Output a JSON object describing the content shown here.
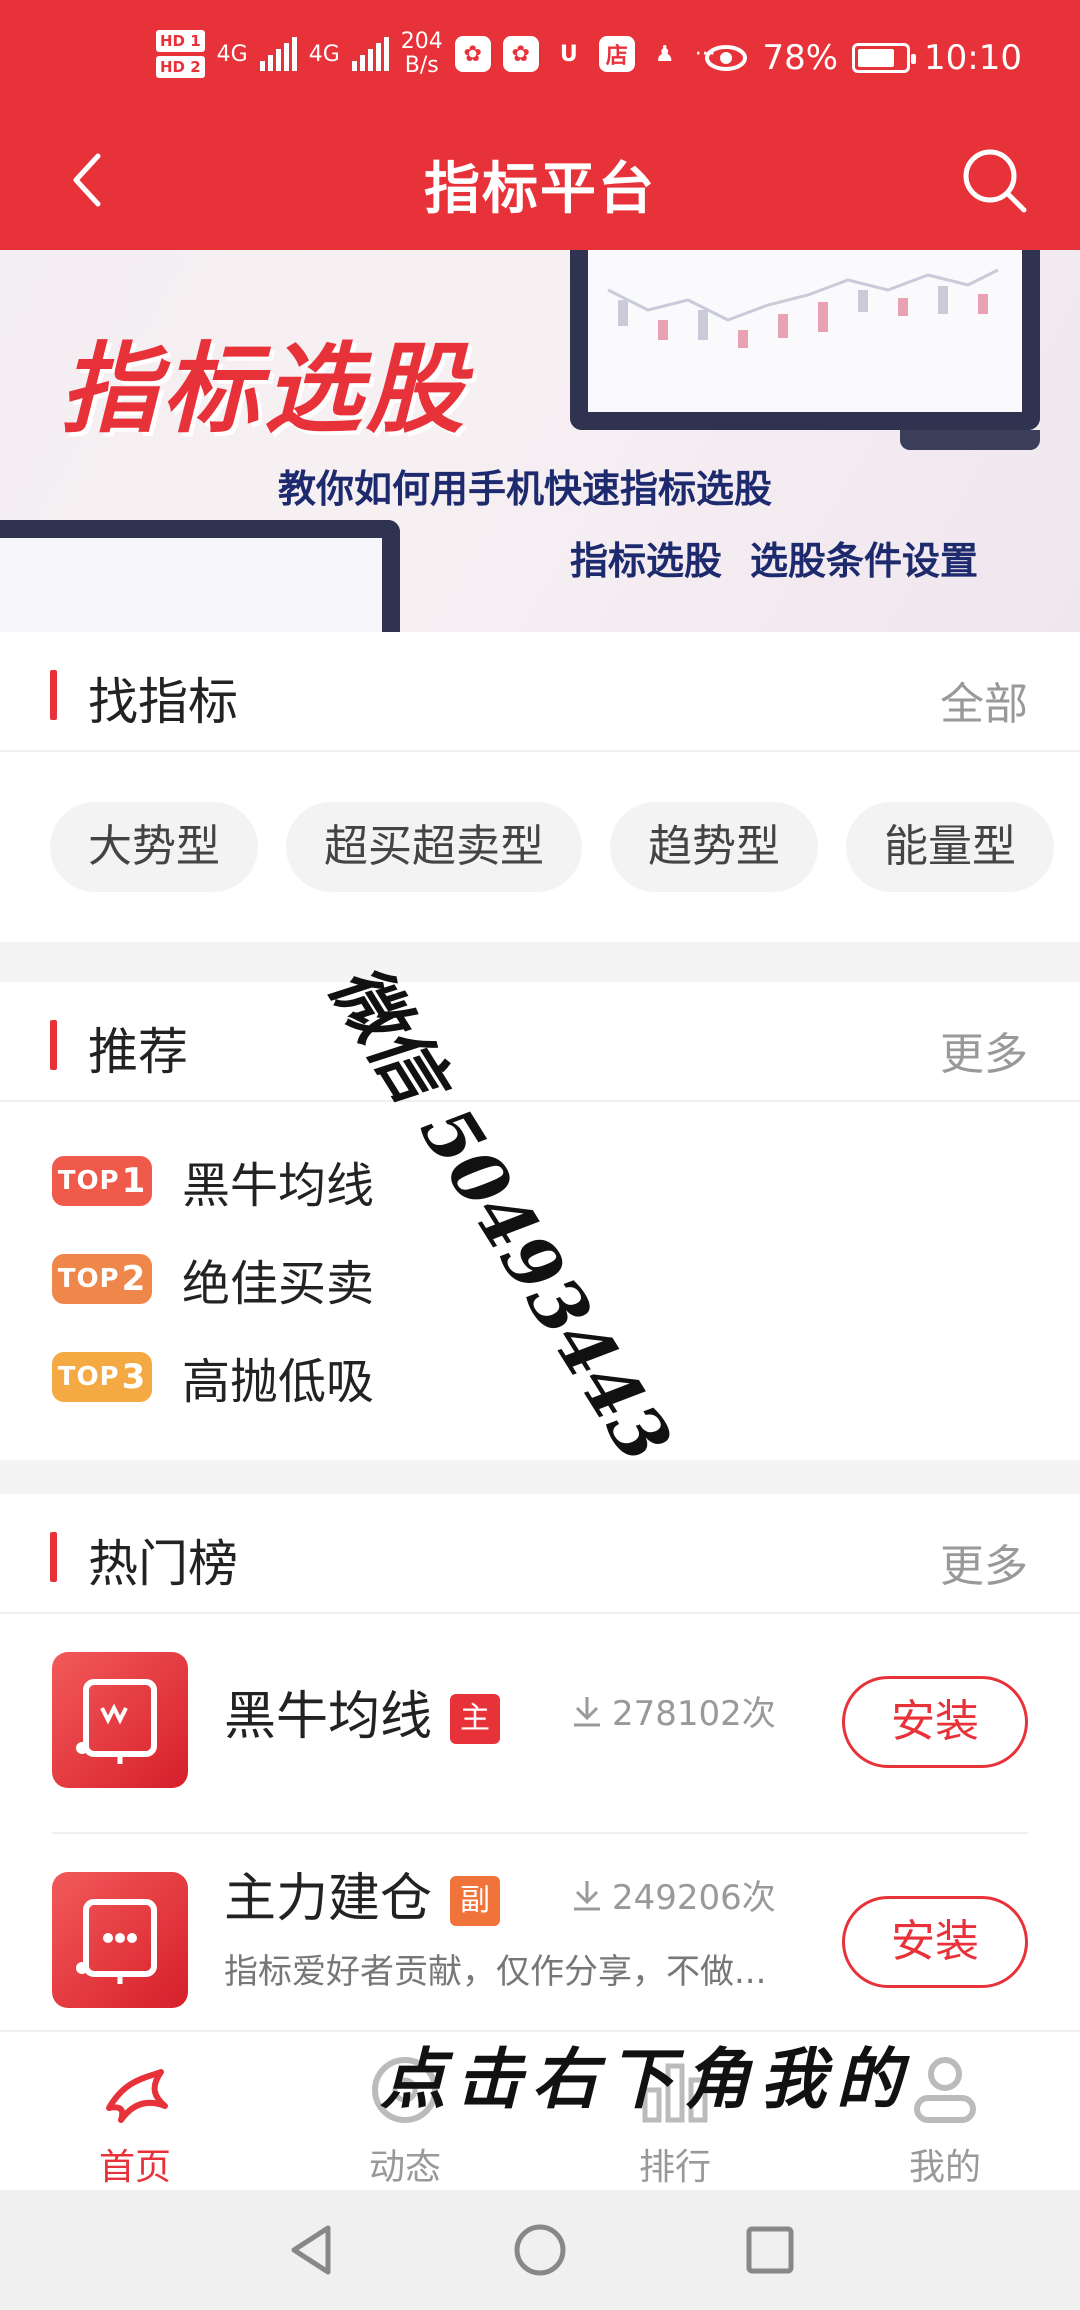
{
  "status_bar": {
    "hd1": "HD 1",
    "hd2": "HD 2",
    "net1": "4G",
    "net2": "4G",
    "speed_value": "204",
    "speed_unit": "B/s",
    "store_icon_label": "店",
    "more": "···",
    "battery": "78%",
    "battery_level": 0.78,
    "time": "10:10"
  },
  "header": {
    "title": "指标平台",
    "back_icon": "chevron-left-icon",
    "search_icon": "search-icon"
  },
  "banner": {
    "headline": "指标选股",
    "subtitle": "教你如何用手机快速指标选股",
    "tag1": "指标选股",
    "tag2": "选股条件设置"
  },
  "find_section": {
    "title": "找指标",
    "more": "全部",
    "chips": [
      "大势型",
      "超买超卖型",
      "趋势型",
      "能量型"
    ]
  },
  "recommend_section": {
    "title": "推荐",
    "more": "更多",
    "items": [
      {
        "badge": "TOP",
        "rank": "1",
        "name": "黑牛均线",
        "color": "#ef5a4a"
      },
      {
        "badge": "TOP",
        "rank": "2",
        "name": "绝佳买卖",
        "color": "#f0874a"
      },
      {
        "badge": "TOP",
        "rank": "3",
        "name": "高抛低吸",
        "color": "#f5a942"
      }
    ]
  },
  "hot_section": {
    "title": "热门榜",
    "more": "更多",
    "items": [
      {
        "name": "黑牛均线",
        "tag": "主",
        "tag_color": "#e8323a",
        "downloads": "278102次",
        "action": "安装",
        "desc": ""
      },
      {
        "name": "主力建仓",
        "tag": "副",
        "tag_color": "#f0733a",
        "downloads": "249206次",
        "action": "安装",
        "desc": "指标爱好者贡献，仅作分享，不做..."
      }
    ]
  },
  "bottom_nav": [
    {
      "label": "首页",
      "icon": "home-icon",
      "active": true
    },
    {
      "label": "动态",
      "icon": "moments-icon",
      "active": false
    },
    {
      "label": "排行",
      "icon": "ranking-icon",
      "active": false
    },
    {
      "label": "我的",
      "icon": "profile-icon",
      "active": false
    }
  ],
  "overlays": {
    "handwriting_top": "微信 50493443",
    "handwriting_bottom": "点击右下角我的"
  },
  "colors": {
    "accent": "#e8323a",
    "banner_text": "#1e2a6e"
  }
}
